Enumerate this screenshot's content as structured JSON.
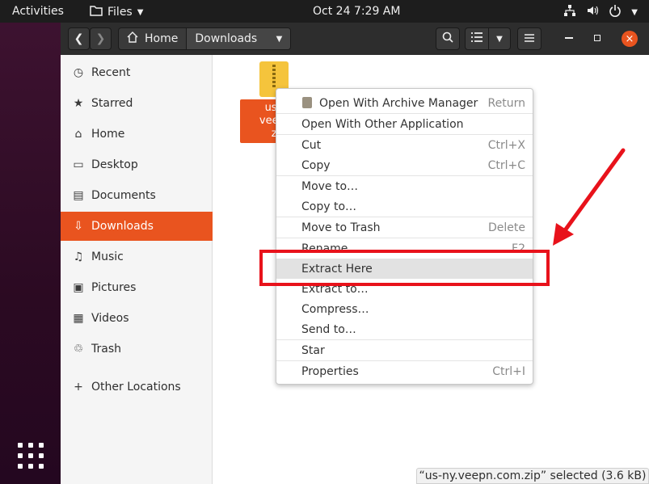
{
  "topbar": {
    "activities": "Activities",
    "app_menu": "Files",
    "clock": "Oct 24  7:29 AM"
  },
  "headerbar": {
    "path": {
      "home": "Home",
      "current": "Downloads"
    },
    "close_glyph": "×"
  },
  "sidebar": {
    "items": [
      {
        "label": "Recent",
        "icon": "clock-icon"
      },
      {
        "label": "Starred",
        "icon": "star-icon"
      },
      {
        "label": "Home",
        "icon": "home-icon"
      },
      {
        "label": "Desktop",
        "icon": "desktop-icon"
      },
      {
        "label": "Documents",
        "icon": "document-icon"
      },
      {
        "label": "Downloads",
        "icon": "download-icon"
      },
      {
        "label": "Music",
        "icon": "music-icon"
      },
      {
        "label": "Pictures",
        "icon": "picture-icon"
      },
      {
        "label": "Videos",
        "icon": "video-icon"
      },
      {
        "label": "Trash",
        "icon": "trash-icon"
      }
    ],
    "other_locations": "Other Locations"
  },
  "file": {
    "label_line1": "us-c",
    "label_line2": "veepn",
    "label_line3": "zi"
  },
  "context_menu": {
    "items": [
      {
        "label": "Open With Archive Manager",
        "accel": "Return"
      },
      {
        "label": "Open With Other Application",
        "accel": ""
      },
      {
        "label": "Cut",
        "accel": "Ctrl+X"
      },
      {
        "label": "Copy",
        "accel": "Ctrl+C"
      },
      {
        "label": "Move to…",
        "accel": ""
      },
      {
        "label": "Copy to…",
        "accel": ""
      },
      {
        "label": "Move to Trash",
        "accel": "Delete"
      },
      {
        "label": "Rename…",
        "accel": "F2"
      },
      {
        "label": "Extract Here",
        "accel": ""
      },
      {
        "label": "Extract to…",
        "accel": ""
      },
      {
        "label": "Compress…",
        "accel": ""
      },
      {
        "label": "Send to…",
        "accel": ""
      },
      {
        "label": "Star",
        "accel": ""
      },
      {
        "label": "Properties",
        "accel": "Ctrl+I"
      }
    ]
  },
  "status": "“us-ny.veepn.com.zip” selected  (3.6 kB)",
  "colors": {
    "accent": "#e9541f",
    "annotation": "#e8121b"
  }
}
